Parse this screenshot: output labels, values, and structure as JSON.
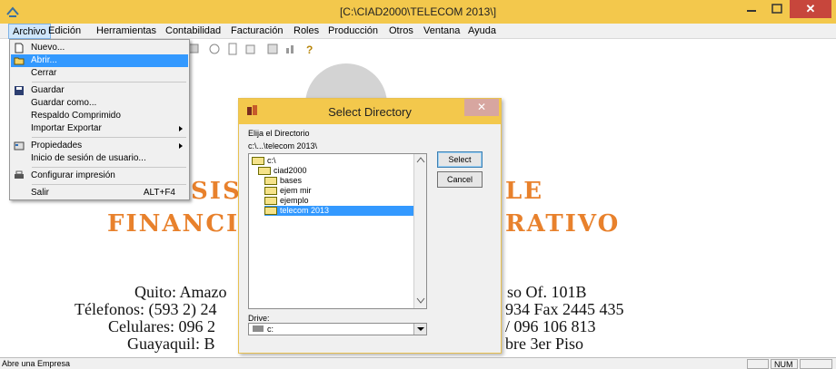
{
  "window": {
    "title": "[C:\\CIAD2000\\TELECOM 2013\\]",
    "close_glyph": "✕"
  },
  "menubar": {
    "items": [
      "Archivo",
      "Edición",
      "Herramientas",
      "Contabilidad",
      "Facturación",
      "Roles",
      "Producción",
      "Otros",
      "Ventana",
      "Ayuda"
    ]
  },
  "archivo_menu": {
    "items": [
      {
        "label": "Nuevo...",
        "icon": "new-document-icon"
      },
      {
        "label": "Abrir...",
        "icon": "open-folder-icon",
        "highlighted": true
      },
      {
        "label": "Cerrar"
      },
      {
        "label": "Guardar",
        "icon": "save-icon"
      },
      {
        "label": "Guardar como..."
      },
      {
        "label": "Respaldo Comprimido"
      },
      {
        "label": "Importar Exportar",
        "submenu": true
      },
      {
        "label": "Propiedades",
        "icon": "properties-icon",
        "submenu": true
      },
      {
        "label": "Inicio de sesión de usuario..."
      },
      {
        "label": "Configurar impresión",
        "icon": "printer-icon"
      },
      {
        "label": "Salir",
        "accelerator": "ALT+F4"
      }
    ]
  },
  "background": {
    "brand_line1_left": "SIS",
    "brand_line1_right": "LE",
    "brand_line2_left": "FINANCI",
    "brand_line2_right": "RATIVO",
    "address": [
      {
        "left": "Quito: Amazo",
        "right": "so Of. 101B"
      },
      {
        "left": "Télefonos: (593 2) 24",
        "right": "934  Fax 2445 435"
      },
      {
        "left": "Celulares: 096 2",
        "right": "/ 096 106 813"
      },
      {
        "left": "Guayaquil: B",
        "right": "bre 3er Piso"
      }
    ]
  },
  "dialog": {
    "title": "Select Directory",
    "close_glyph": "✕",
    "label_directory": "Elija el Directorio",
    "current_path": "c:\\...\\telecom 2013\\",
    "tree": [
      {
        "label": "c:\\",
        "level": 0
      },
      {
        "label": "ciad2000",
        "level": 1
      },
      {
        "label": "bases",
        "level": 2
      },
      {
        "label": "ejem mir",
        "level": 2
      },
      {
        "label": "ejemplo",
        "level": 2
      },
      {
        "label": "telecom 2013",
        "level": 2,
        "selected": true
      }
    ],
    "select_label": "Select",
    "cancel_label": "Cancel",
    "drive_label": "Drive:",
    "drive_value": "c:"
  },
  "statusbar": {
    "message": "Abre una Empresa",
    "num_indicator": "NUM"
  },
  "colors": {
    "titlebar": "#f3c84c",
    "brand_orange": "#e8812c",
    "selection": "#3399ff",
    "close_button": "#c7463c"
  }
}
